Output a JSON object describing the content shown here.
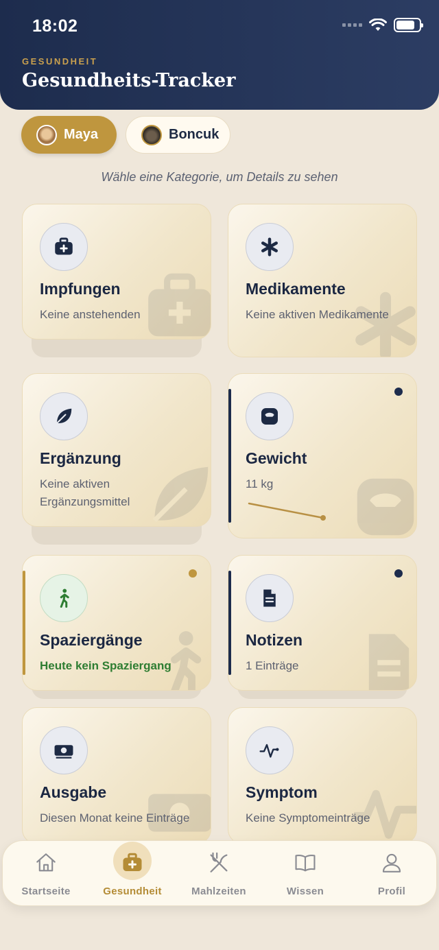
{
  "status_bar": {
    "time": "18:02"
  },
  "header": {
    "eyebrow": "GESUNDHEIT",
    "title": "Gesundheits-Tracker"
  },
  "pets": [
    {
      "name": "Maya",
      "selected": true
    },
    {
      "name": "Boncuk",
      "selected": false
    }
  ],
  "hint": "Wähle eine Kategorie, um Details zu sehen",
  "cards": [
    {
      "title": "Impfungen",
      "subtitle": "Keine anstehenden",
      "icon": "medical-kit-icon"
    },
    {
      "title": "Medikamente",
      "subtitle": "Keine aktiven Medikamente",
      "icon": "asterisk-icon"
    },
    {
      "title": "Ergänzung",
      "subtitle": "Keine aktiven Ergänzungsmittel",
      "icon": "leaf-icon"
    },
    {
      "title": "Gewicht",
      "subtitle": "11 kg",
      "icon": "scale-icon"
    },
    {
      "title": "Spaziergänge",
      "subtitle": "Heute kein Spaziergang",
      "icon": "walking-icon"
    },
    {
      "title": "Notizen",
      "subtitle": "1 Einträge",
      "icon": "document-icon"
    },
    {
      "title": "Ausgabe",
      "subtitle": "Diesen Monat keine Einträge",
      "icon": "money-icon"
    },
    {
      "title": "Symptom",
      "subtitle": "Keine Symptomeinträge",
      "icon": "pulse-icon"
    }
  ],
  "colors": {
    "navy": "#1d2c4d",
    "gold": "#bf963e",
    "green": "#2e7d32",
    "background": "#efe7da"
  },
  "bottom_nav": [
    {
      "label": "Startseite",
      "icon": "home-icon",
      "active": false
    },
    {
      "label": "Gesundheit",
      "icon": "medical-kit-icon",
      "active": true
    },
    {
      "label": "Mahlzeiten",
      "icon": "utensils-icon",
      "active": false
    },
    {
      "label": "Wissen",
      "icon": "book-icon",
      "active": false
    },
    {
      "label": "Profil",
      "icon": "user-icon",
      "active": false
    }
  ]
}
